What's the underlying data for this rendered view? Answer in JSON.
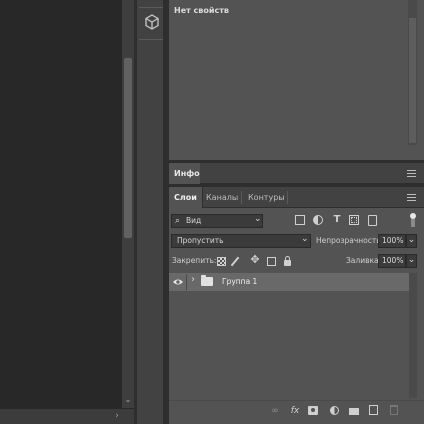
{
  "properties": {
    "title": "Нет свойств"
  },
  "info_panel": {
    "tab": "Инфо"
  },
  "layers_panel": {
    "tabs": [
      {
        "label": "Слои",
        "active": true
      },
      {
        "label": "Каналы",
        "active": false
      },
      {
        "label": "Контуры",
        "active": false
      }
    ],
    "filter": {
      "label": "Вид",
      "search_icon": "⌕"
    },
    "blend_mode": "Пропустить",
    "opacity_label": "Непрозрачность:",
    "opacity_value": "100%",
    "lock_label": "Закрепить:",
    "fill_label": "Заливка:",
    "fill_value": "100%",
    "layers": [
      {
        "name": "Группа 1",
        "type": "group",
        "visible": true
      }
    ],
    "footer_icons": [
      "link-icon",
      "fx-icon",
      "mask-icon",
      "adjustment-icon",
      "folder-icon",
      "new-layer-icon",
      "trash-icon"
    ]
  },
  "glyphs": {
    "chevron_down": "⌄",
    "chevron_right": "›",
    "eye": "◉",
    "fx": "fx",
    "link": "∞",
    "trash": "🗑",
    "type_filter": "T"
  }
}
